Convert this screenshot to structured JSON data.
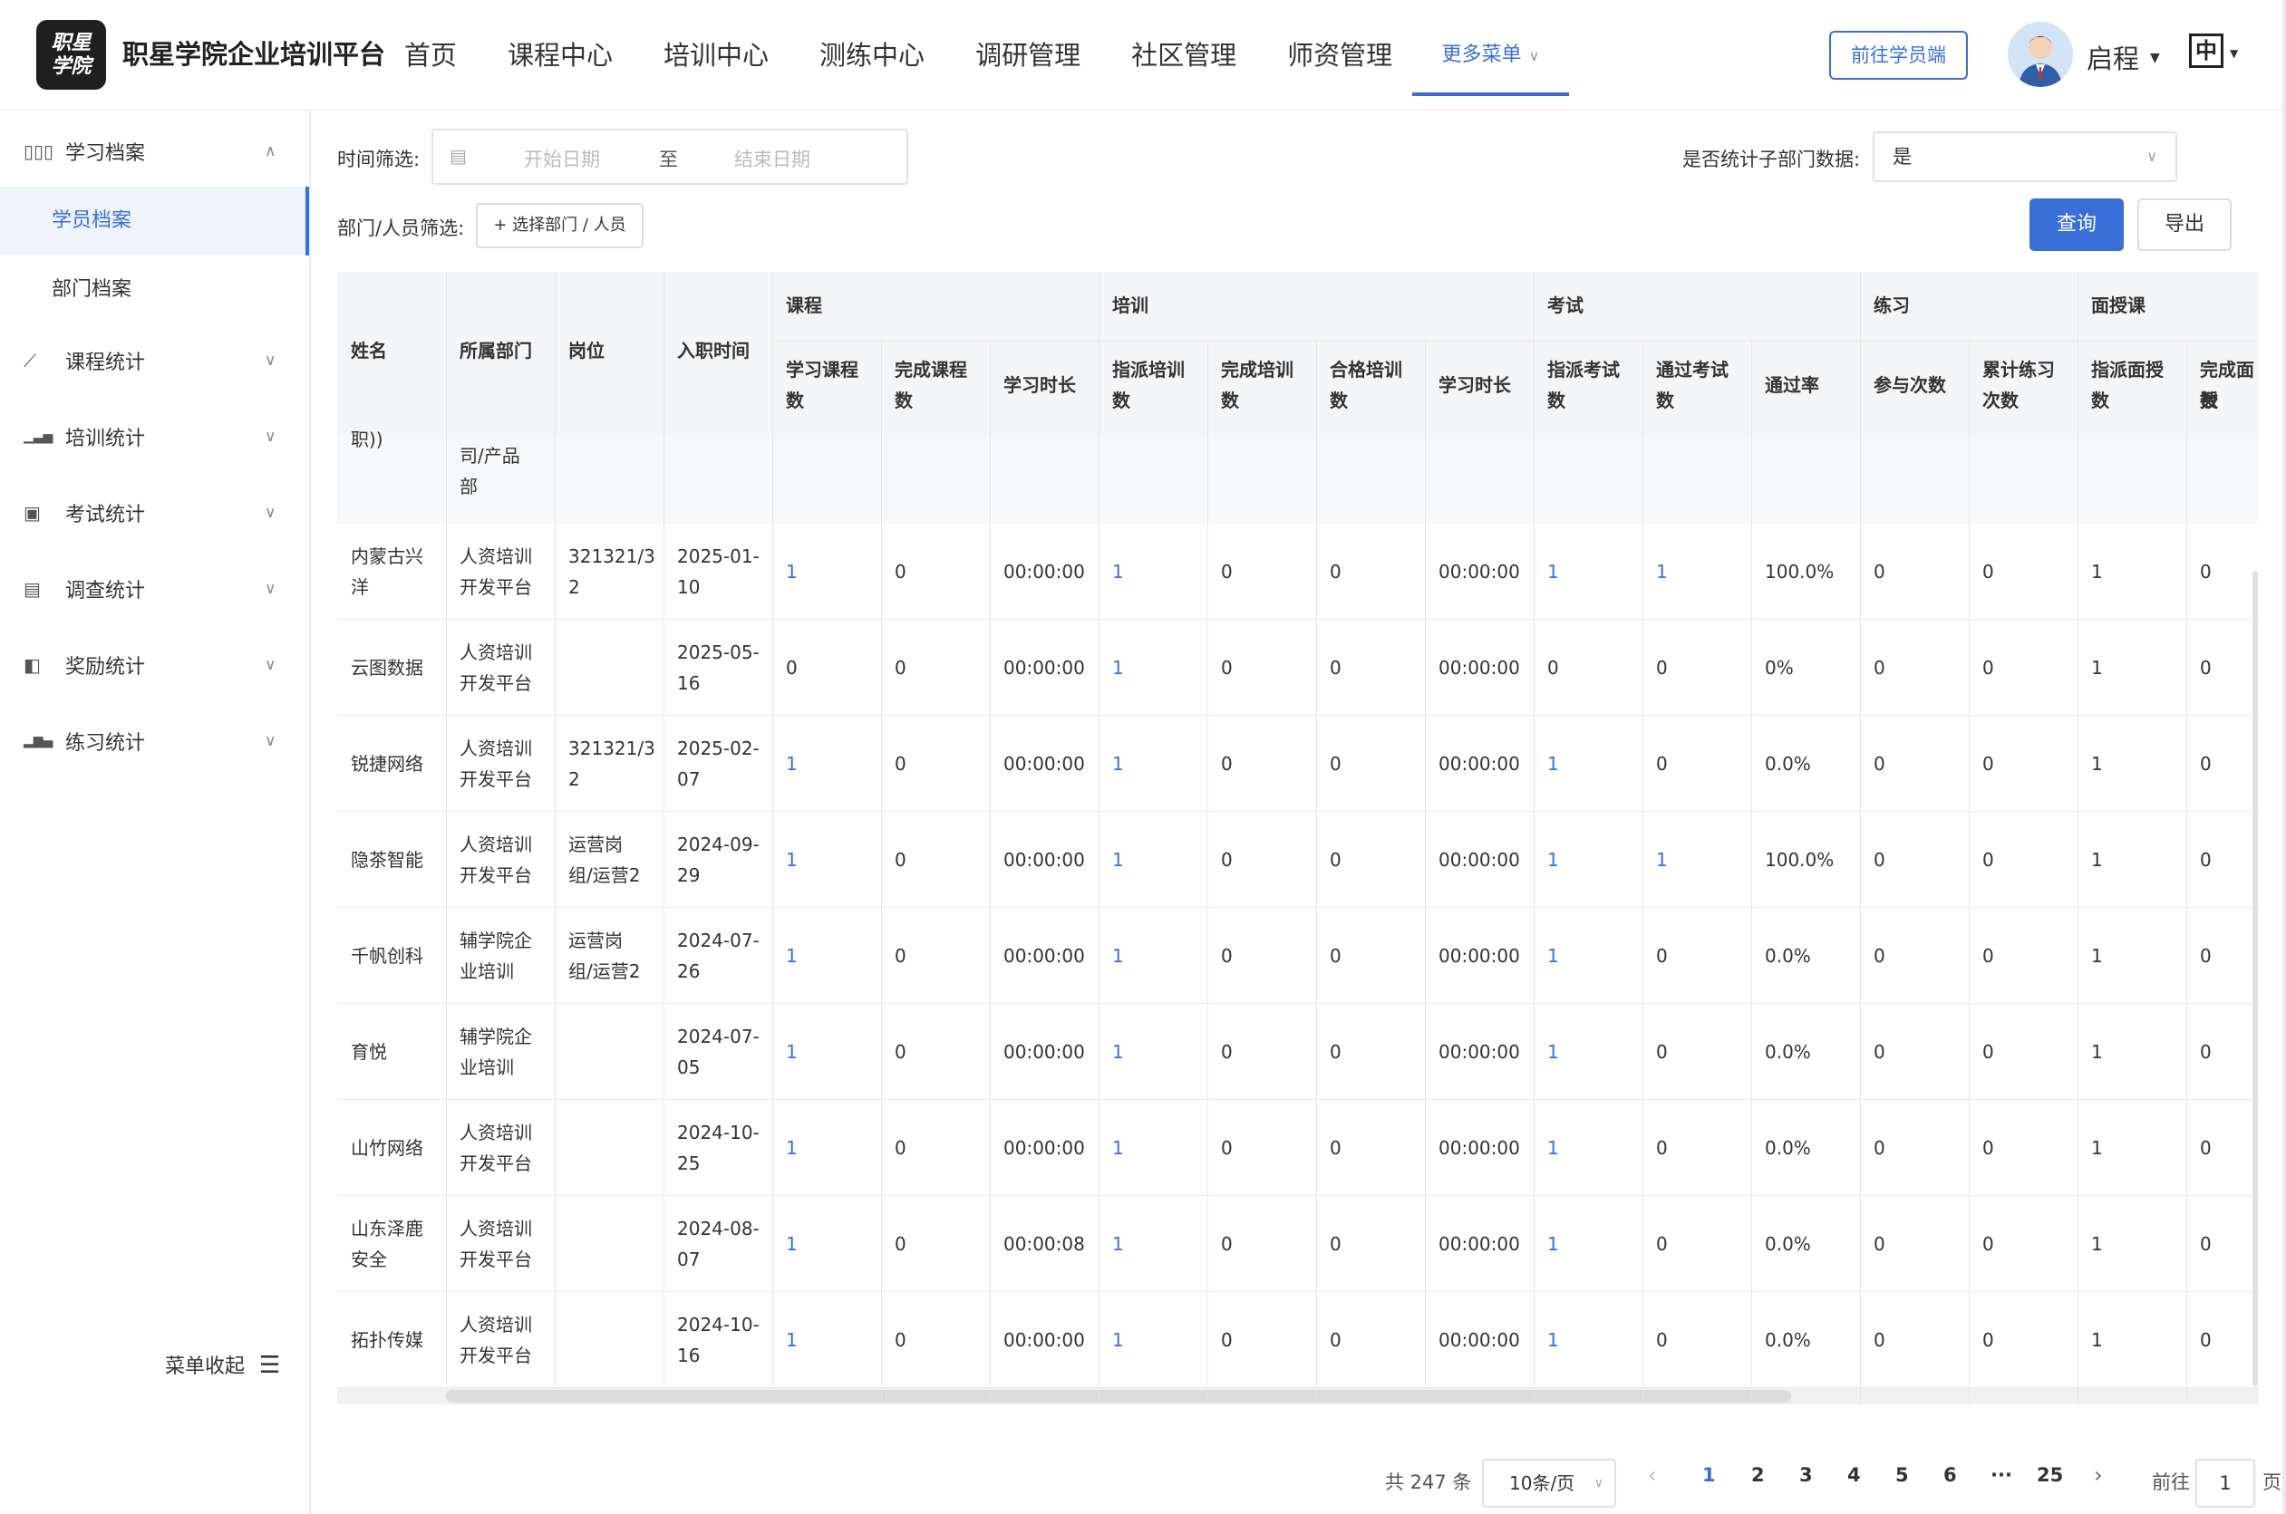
{
  "header": {
    "logo_text": [
      "职星",
      "学院"
    ],
    "brand": "职星学院企业培训平台",
    "nav": [
      "首页",
      "课程中心",
      "培训中心",
      "测练中心",
      "调研管理",
      "社区管理",
      "师资管理"
    ],
    "more_menu": "更多菜单",
    "student_button": "前往学员端",
    "user_name": "启程",
    "lang": "中"
  },
  "sidebar": {
    "groups": [
      {
        "icon": "archive-icon",
        "glyph": "▯▯▯",
        "label": "学习档案",
        "expanded": true
      },
      {
        "icon": "line-chart-icon",
        "glyph": "⟋",
        "label": "课程统计"
      },
      {
        "icon": "bar-chart-icon",
        "glyph": "▁▃▅",
        "label": "培训统计"
      },
      {
        "icon": "exam-icon",
        "glyph": "▣",
        "label": "考试统计"
      },
      {
        "icon": "survey-icon",
        "glyph": "▤",
        "label": "调查统计"
      },
      {
        "icon": "reward-icon",
        "glyph": "◧",
        "label": "奖励统计"
      },
      {
        "icon": "practice-icon",
        "glyph": "▂▆▄",
        "label": "练习统计"
      }
    ],
    "sub_items": [
      "学员档案",
      "部门档案"
    ],
    "collapse": "菜单收起"
  },
  "filters": {
    "time_label": "时间筛选:",
    "start_placeholder": "开始日期",
    "to": "至",
    "end_placeholder": "结束日期",
    "subdept_label": "是否统计子部门数据:",
    "subdept_value": "是",
    "dept_label": "部门/人员筛选:",
    "pick_button": "+ 选择部门 / 人员",
    "query": "查询",
    "export": "导出"
  },
  "table": {
    "fixed_headers": [
      "姓名",
      "所属部门",
      "岗位",
      "入职时间"
    ],
    "groups": [
      "课程",
      "培训",
      "考试",
      "练习",
      "面授课"
    ],
    "sub_headers": [
      [
        "学习课程",
        "数"
      ],
      [
        "完成课程",
        "数"
      ],
      [
        "学习时长"
      ],
      [
        "指派培训",
        "数"
      ],
      [
        "完成培训",
        "数"
      ],
      [
        "合格培训",
        "数"
      ],
      [
        "学习时长"
      ],
      [
        "指派考试",
        "数"
      ],
      [
        "通过考试",
        "数"
      ],
      [
        "通过率"
      ],
      [
        "参与次数"
      ],
      [
        "累计练习",
        "次数"
      ],
      [
        "指派面授",
        "数"
      ],
      [
        "完成面授",
        "数"
      ]
    ],
    "partial_row": {
      "name": "职))",
      "dept": [
        "司/产品",
        "部"
      ]
    },
    "rows": [
      {
        "name": [
          "内蒙古兴",
          "洋"
        ],
        "dept": [
          "人资培训",
          "开发平台"
        ],
        "post": [
          "321321/3",
          "2"
        ],
        "date": [
          "2025-01-",
          "10"
        ],
        "vals": [
          "1",
          "0",
          "00:00:00",
          "1",
          "0",
          "0",
          "00:00:00",
          "1",
          "1",
          "100.0%",
          "0",
          "0",
          "1",
          "0"
        ]
      },
      {
        "name": [
          "云图数据"
        ],
        "dept": [
          "人资培训",
          "开发平台"
        ],
        "post": [],
        "date": [
          "2025-05-",
          "16"
        ],
        "vals": [
          "0",
          "0",
          "00:00:00",
          "1",
          "0",
          "0",
          "00:00:00",
          "0",
          "0",
          "0%",
          "0",
          "0",
          "1",
          "0"
        ]
      },
      {
        "name": [
          "锐捷网络"
        ],
        "dept": [
          "人资培训",
          "开发平台"
        ],
        "post": [
          "321321/3",
          "2"
        ],
        "date": [
          "2025-02-",
          "07"
        ],
        "vals": [
          "1",
          "0",
          "00:00:00",
          "1",
          "0",
          "0",
          "00:00:00",
          "1",
          "0",
          "0.0%",
          "0",
          "0",
          "1",
          "0"
        ]
      },
      {
        "name": [
          "隐茶智能"
        ],
        "dept": [
          "人资培训",
          "开发平台"
        ],
        "post": [
          "运营岗",
          "组/运营2"
        ],
        "date": [
          "2024-09-",
          "29"
        ],
        "vals": [
          "1",
          "0",
          "00:00:00",
          "1",
          "0",
          "0",
          "00:00:00",
          "1",
          "1",
          "100.0%",
          "0",
          "0",
          "1",
          "0"
        ]
      },
      {
        "name": [
          "千帆创科"
        ],
        "dept": [
          "辅学院企",
          "业培训"
        ],
        "post": [
          "运营岗",
          "组/运营2"
        ],
        "date": [
          "2024-07-",
          "26"
        ],
        "vals": [
          "1",
          "0",
          "00:00:00",
          "1",
          "0",
          "0",
          "00:00:00",
          "1",
          "0",
          "0.0%",
          "0",
          "0",
          "1",
          "0"
        ]
      },
      {
        "name": [
          "育悦"
        ],
        "dept": [
          "辅学院企",
          "业培训"
        ],
        "post": [],
        "date": [
          "2024-07-",
          "05"
        ],
        "vals": [
          "1",
          "0",
          "00:00:00",
          "1",
          "0",
          "0",
          "00:00:00",
          "1",
          "0",
          "0.0%",
          "0",
          "0",
          "1",
          "0"
        ]
      },
      {
        "name": [
          "山竹网络"
        ],
        "dept": [
          "人资培训",
          "开发平台"
        ],
        "post": [],
        "date": [
          "2024-10-",
          "25"
        ],
        "vals": [
          "1",
          "0",
          "00:00:00",
          "1",
          "0",
          "0",
          "00:00:00",
          "1",
          "0",
          "0.0%",
          "0",
          "0",
          "1",
          "0"
        ]
      },
      {
        "name": [
          "山东泽鹿",
          "安全"
        ],
        "dept": [
          "人资培训",
          "开发平台"
        ],
        "post": [],
        "date": [
          "2024-08-",
          "07"
        ],
        "vals": [
          "1",
          "0",
          "00:00:08",
          "1",
          "0",
          "0",
          "00:00:00",
          "1",
          "0",
          "0.0%",
          "0",
          "0",
          "1",
          "0"
        ]
      },
      {
        "name": [
          "拓扑传媒"
        ],
        "dept": [
          "人资培训",
          "开发平台"
        ],
        "post": [],
        "date": [
          "2024-10-",
          "16"
        ],
        "vals": [
          "1",
          "0",
          "00:00:00",
          "1",
          "0",
          "0",
          "00:00:00",
          "1",
          "0",
          "0.0%",
          "0",
          "0",
          "1",
          "0"
        ]
      }
    ]
  },
  "pagination": {
    "total": "共 247 条",
    "page_size": "10条/页",
    "pages": [
      "1",
      "2",
      "3",
      "4",
      "5",
      "6",
      "···",
      "25"
    ],
    "current": "1",
    "goto_label": "前往",
    "goto_value": "1",
    "page_suffix": "页"
  },
  "colors": {
    "accent": "#3a6fd8",
    "header_bg": "#f4f5f7"
  }
}
